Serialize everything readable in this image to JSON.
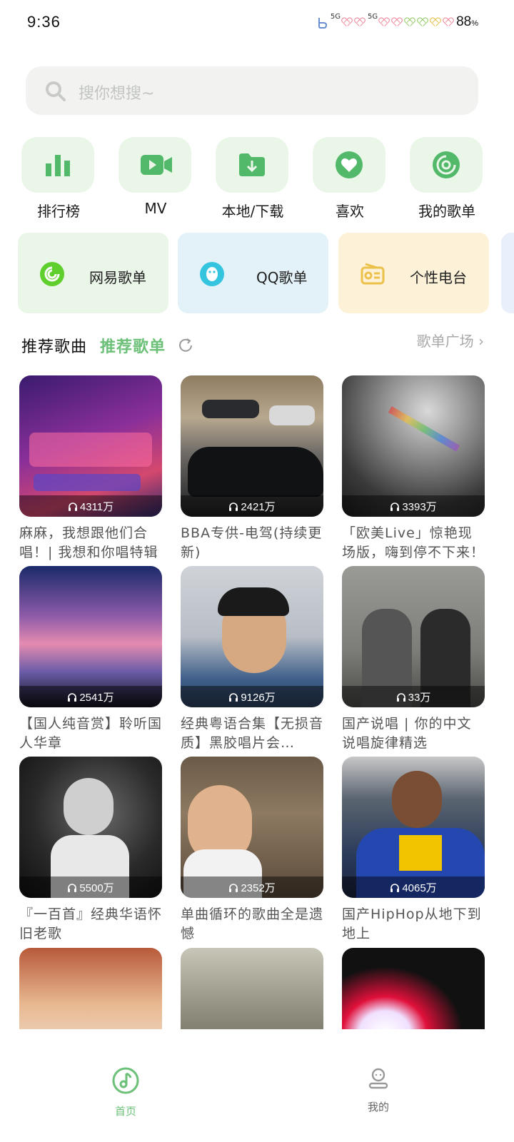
{
  "status": {
    "time": "9:36",
    "signal1": "5G",
    "signal2": "5G",
    "battery": "88",
    "battery_unit": "%"
  },
  "search": {
    "placeholder": "搜你想搜~"
  },
  "quick_actions": [
    {
      "label": "排行榜",
      "icon": "chart-bars-icon"
    },
    {
      "label": "MV",
      "icon": "video-icon"
    },
    {
      "label": "本地/下载",
      "icon": "folder-download-icon"
    },
    {
      "label": "喜欢",
      "icon": "heart-icon"
    },
    {
      "label": "我的歌单",
      "icon": "disc-icon"
    }
  ],
  "cards": [
    {
      "label": "网易歌单",
      "icon": "netease-icon",
      "bg": "#e9f6e8"
    },
    {
      "label": "QQ歌单",
      "icon": "qq-penguin-icon",
      "bg": "#e3f2f8"
    },
    {
      "label": "个性电台",
      "icon": "radio-icon",
      "bg": "#fdf1d8"
    }
  ],
  "section": {
    "tab1": "推荐歌曲",
    "tab2": "推荐歌单",
    "more": "歌单广场 ›"
  },
  "playlists": [
    {
      "count": "4311万",
      "title": "麻麻，我想跟他们合唱！| 我想和你唱特辑"
    },
    {
      "count": "2421万",
      "title": "BBA专供-电驾(持续更新)"
    },
    {
      "count": "3393万",
      "title": "「欧美Live」惊艳现场版，嗨到停不下来！"
    },
    {
      "count": "2541万",
      "title": "【国人纯音赏】聆听国人华章"
    },
    {
      "count": "9126万",
      "title": "经典粤语合集【无损音质】黑胶唱片会…"
    },
    {
      "count": "33万",
      "title": "国产说唱 | 你的中文说唱旋律精选"
    },
    {
      "count": "5500万",
      "title": "『一百首』经典华语怀旧老歌"
    },
    {
      "count": "2352万",
      "title": "单曲循环的歌曲全是遗憾"
    },
    {
      "count": "4065万",
      "title": "国产HipHop从地下到地上"
    },
    {
      "count": "",
      "title": ""
    },
    {
      "count": "",
      "title": ""
    },
    {
      "count": "",
      "title": ""
    }
  ],
  "nav": [
    {
      "label": "首页",
      "icon": "music-disc-icon",
      "active": true
    },
    {
      "label": "我的",
      "icon": "user-icon",
      "active": false
    }
  ],
  "colors": {
    "accent": "#6cc078",
    "icon_green": "#52b96a",
    "tile_bg": "#e9f6e8"
  }
}
